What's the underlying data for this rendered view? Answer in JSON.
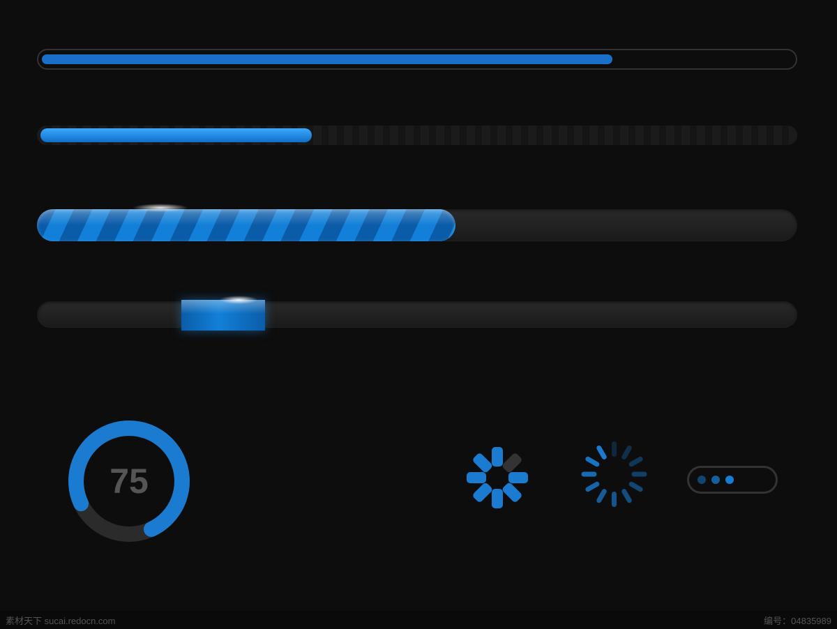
{
  "colors": {
    "accent": "#1a7bd0",
    "accent_bright": "#2a9df4",
    "track_dark": "#1e1e1e",
    "track_mid": "#2a2a2a",
    "petal_dim": "#333333"
  },
  "progress_bars": {
    "bar1_percent": 76,
    "bar2_percent": 36,
    "bar3_percent": 55,
    "bar4_segment_start_percent": 19,
    "bar4_segment_width_percent": 11
  },
  "circular": {
    "value": "75",
    "percent": 75
  },
  "spinner1": {
    "petals": 8,
    "dim_index": 1
  },
  "spinner2": {
    "petals": 12
  },
  "pill_loader": {
    "dots": 3
  },
  "footer": {
    "left_text": "素材天下 sucai.redocn.com",
    "right_label": "编号：",
    "right_value": "04835989"
  }
}
